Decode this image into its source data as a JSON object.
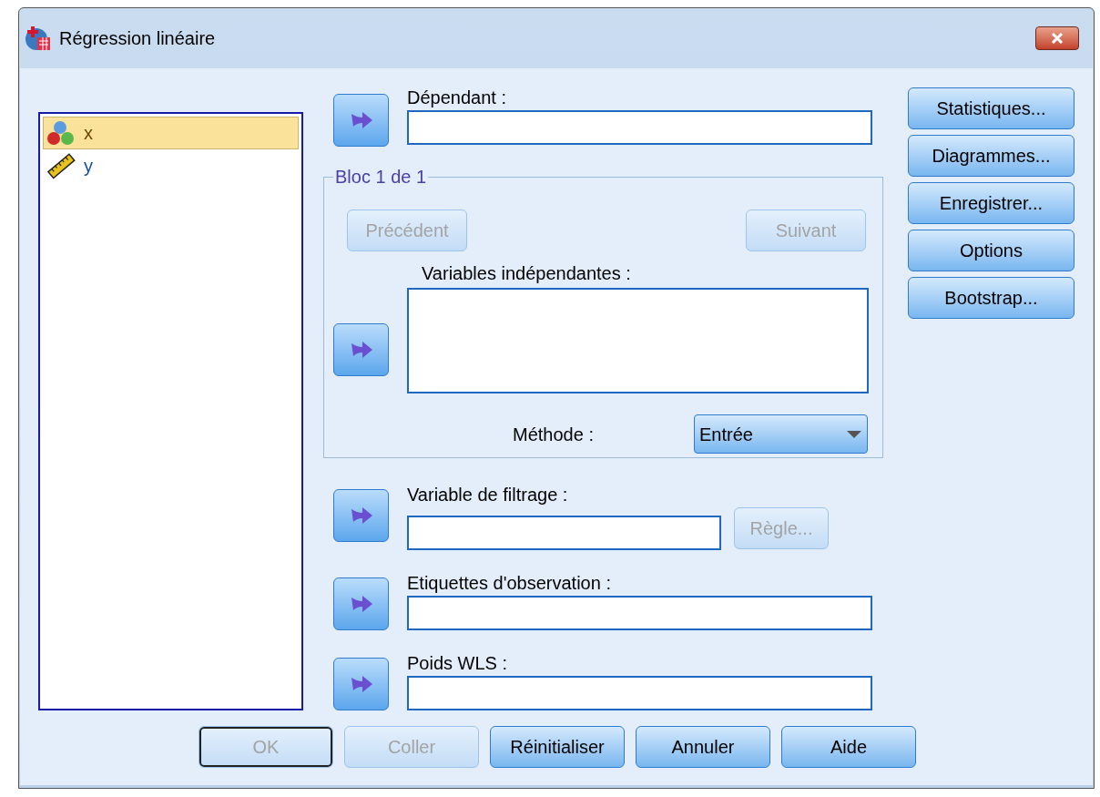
{
  "window": {
    "title": "Régression linéaire"
  },
  "variables": [
    {
      "name": "x",
      "kind": "nominal",
      "selected": true
    },
    {
      "name": "y",
      "kind": "scale",
      "selected": false
    }
  ],
  "dependent": {
    "label": "Dépendant :"
  },
  "block": {
    "title": "Bloc 1 de 1",
    "buttons": [
      {
        "label": "Précédent",
        "disabled": true
      },
      {
        "label": "Suivant",
        "disabled": true
      }
    ],
    "independents_label": "Variables indépendantes :",
    "method": {
      "label": "Méthode :",
      "value": "Entrée"
    }
  },
  "filter": {
    "label": "Variable de filtrage :",
    "rule_button": {
      "label": "Règle...",
      "disabled": true
    }
  },
  "case_labels": {
    "label": "Etiquettes d'observation :"
  },
  "wls": {
    "label": "Poids WLS :"
  },
  "side_buttons": [
    {
      "label": "Statistiques..."
    },
    {
      "label": "Diagrammes..."
    },
    {
      "label": "Enregistrer..."
    },
    {
      "label": "Options"
    },
    {
      "label": "Bootstrap..."
    }
  ],
  "footer_buttons": [
    {
      "label": "OK",
      "disabled": true,
      "default": true
    },
    {
      "label": "Coller",
      "disabled": true,
      "default": false
    },
    {
      "label": "Réinitialiser",
      "disabled": false,
      "default": false
    },
    {
      "label": "Annuler",
      "disabled": false,
      "default": false
    },
    {
      "label": "Aide",
      "disabled": false,
      "default": false
    }
  ]
}
